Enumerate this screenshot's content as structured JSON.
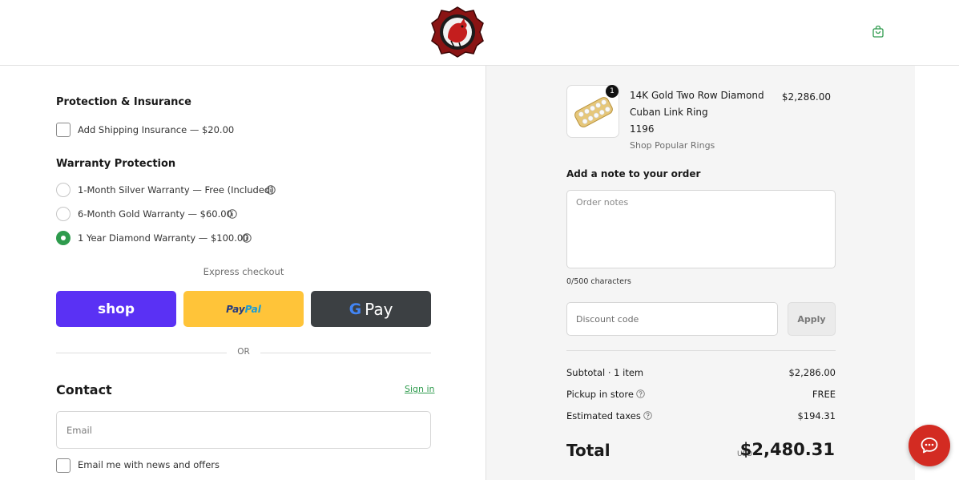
{
  "header": {
    "logo_icon": "rooster-crest-logo",
    "cart_icon": "shopping-bag-icon"
  },
  "protection": {
    "title": "Protection & Insurance",
    "shipping_insurance_label": "Add Shipping Insurance — $20.00",
    "shipping_insurance_checked": false
  },
  "warranty": {
    "title": "Warranty Protection",
    "options": [
      {
        "label": "1-Month Silver Warranty — Free (Included)",
        "selected": false
      },
      {
        "label": "6-Month Gold Warranty — $60.00",
        "selected": false
      },
      {
        "label": "1 Year Diamond Warranty — $100.00",
        "selected": true
      }
    ]
  },
  "express": {
    "label": "Express checkout",
    "shop_label": "shop",
    "paypal_label_1": "Pay",
    "paypal_label_2": "Pal",
    "gpay_g": "G",
    "gpay_label": "Pay",
    "or_label": "OR"
  },
  "contact": {
    "title": "Contact",
    "sign_in": "Sign in",
    "email_placeholder": "Email",
    "newsletter_label": "Email me with news and offers",
    "newsletter_checked": false
  },
  "cart": {
    "item": {
      "name": "14K Gold Two Row Diamond Cuban Link Ring",
      "sku": "1196",
      "vendor": "Shop Popular Rings",
      "price": "$2,286.00",
      "quantity": "1"
    },
    "note_title": "Add a note to your order",
    "note_placeholder": "Order notes",
    "char_count": "0/500 characters",
    "discount_placeholder": "Discount code",
    "apply_label": "Apply",
    "subtotal_label": "Subtotal · 1 item",
    "subtotal_value": "$2,286.00",
    "pickup_label": "Pickup in store",
    "pickup_value": "FREE",
    "taxes_label": "Estimated taxes",
    "taxes_value": "$194.31",
    "total_label": "Total",
    "total_currency": "USD",
    "total_value": "$2,480.31"
  },
  "chat": {
    "icon": "chat-bubble-icon"
  },
  "colors": {
    "accent_green": "#2e9b4d",
    "shop_purple": "#5a31f4",
    "paypal_yellow": "#ffc439",
    "gpay_dark": "#3c4043",
    "chat_red": "#d32b22"
  }
}
